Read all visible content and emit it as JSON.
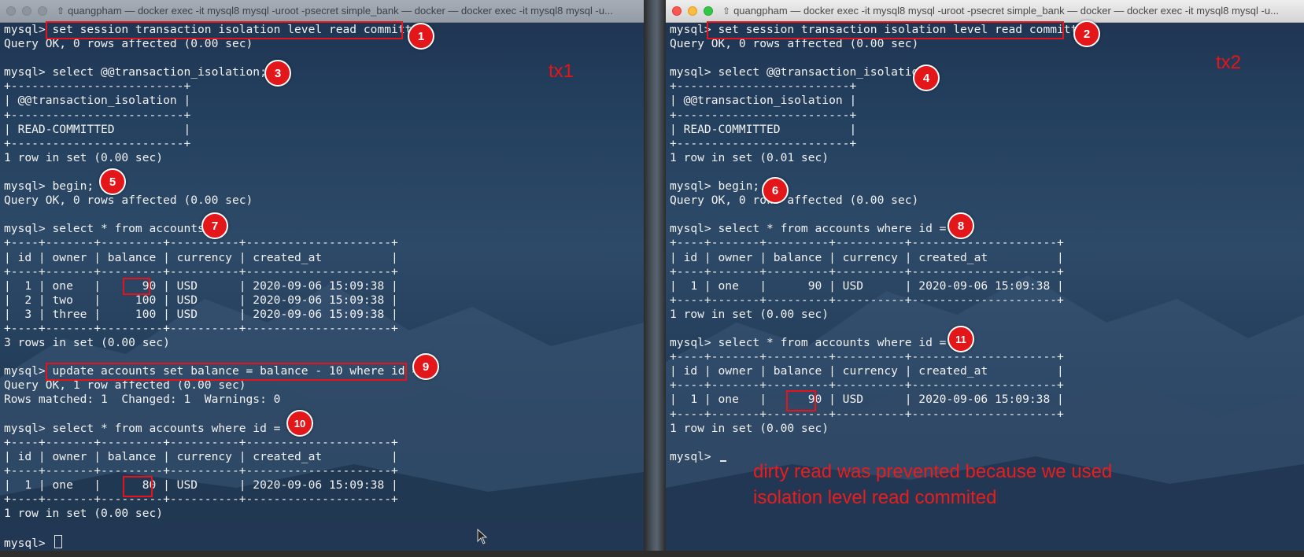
{
  "left_window": {
    "title": "quangpham — docker exec -it mysql8 mysql -uroot -psecret simple_bank — docker — docker exec -it mysql8 mysql -u...",
    "tx_label": "tx1",
    "lines": [
      "mysql> set session transaction isolation level read committed;",
      "Query OK, 0 rows affected (0.00 sec)",
      "",
      "mysql> select @@transaction_isolation;",
      "+-------------------------+",
      "| @@transaction_isolation |",
      "+-------------------------+",
      "| READ-COMMITTED          |",
      "+-------------------------+",
      "1 row in set (0.00 sec)",
      "",
      "mysql> begin;",
      "Query OK, 0 rows affected (0.00 sec)",
      "",
      "mysql> select * from accounts;",
      "+----+-------+---------+----------+---------------------+",
      "| id | owner | balance | currency | created_at          |",
      "+----+-------+---------+----------+---------------------+",
      "|  1 | one   |      90 | USD      | 2020-09-06 15:09:38 |",
      "|  2 | two   |     100 | USD      | 2020-09-06 15:09:38 |",
      "|  3 | three |     100 | USD      | 2020-09-06 15:09:38 |",
      "+----+-------+---------+----------+---------------------+",
      "3 rows in set (0.00 sec)",
      "",
      "mysql> update accounts set balance = balance - 10 where id = 1;",
      "Query OK, 1 row affected (0.00 sec)",
      "Rows matched: 1  Changed: 1  Warnings: 0",
      "",
      "mysql> select * from accounts where id = 1;",
      "+----+-------+---------+----------+---------------------+",
      "| id | owner | balance | currency | created_at          |",
      "+----+-------+---------+----------+---------------------+",
      "|  1 | one   |      80 | USD      | 2020-09-06 15:09:38 |",
      "+----+-------+---------+----------+---------------------+",
      "1 row in set (0.00 sec)",
      "",
      "mysql> "
    ],
    "badges": [
      "1",
      "3",
      "5",
      "7",
      "9",
      "10"
    ]
  },
  "right_window": {
    "title": "quangpham — docker exec -it mysql8 mysql -uroot -psecret simple_bank — docker — docker exec -it mysql8 mysql -u...",
    "tx_label": "tx2",
    "lines": [
      "mysql> set session transaction isolation level read committed;",
      "Query OK, 0 rows affected (0.00 sec)",
      "",
      "mysql> select @@transaction_isolation;",
      "+-------------------------+",
      "| @@transaction_isolation |",
      "+-------------------------+",
      "| READ-COMMITTED          |",
      "+-------------------------+",
      "1 row in set (0.01 sec)",
      "",
      "mysql> begin;",
      "Query OK, 0 rows affected (0.00 sec)",
      "",
      "mysql> select * from accounts where id = 1;",
      "+----+-------+---------+----------+---------------------+",
      "| id | owner | balance | currency | created_at          |",
      "+----+-------+---------+----------+---------------------+",
      "|  1 | one   |      90 | USD      | 2020-09-06 15:09:38 |",
      "+----+-------+---------+----------+---------------------+",
      "1 row in set (0.00 sec)",
      "",
      "mysql> select * from accounts where id = 1;",
      "+----+-------+---------+----------+---------------------+",
      "| id | owner | balance | currency | created_at          |",
      "+----+-------+---------+----------+---------------------+",
      "|  1 | one   |      90 | USD      | 2020-09-06 15:09:38 |",
      "+----+-------+---------+----------+---------------------+",
      "1 row in set (0.00 sec)",
      "",
      "mysql> "
    ],
    "badges": [
      "2",
      "4",
      "6",
      "8",
      "11"
    ],
    "note_line1": "dirty read was prevented because we used",
    "note_line2": "isolation level read commited"
  },
  "colors": {
    "annotation_red": "#e8131a",
    "terminal_text": "#f2f2f2"
  }
}
